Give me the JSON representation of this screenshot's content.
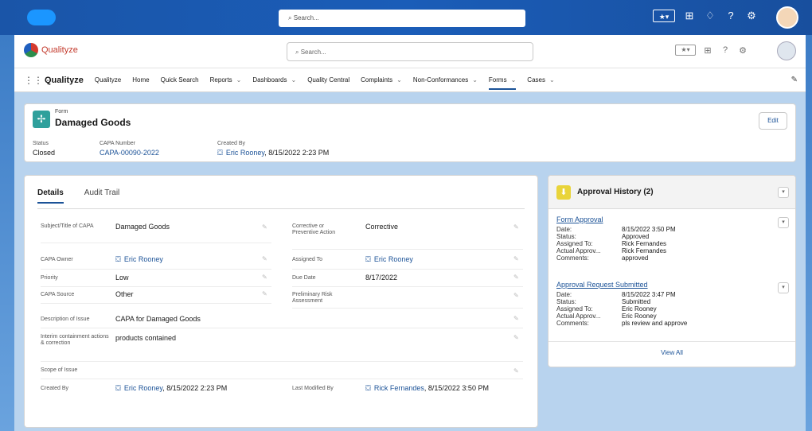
{
  "outer": {
    "search_placeholder": "Search...",
    "icons": [
      "favorites-icon",
      "add-icon",
      "bell-icon",
      "help-icon",
      "gear-icon"
    ]
  },
  "app": {
    "brand_name": "Qualityze",
    "search_placeholder": "Search...",
    "nav": {
      "app_name": "Qualityze",
      "items": [
        {
          "label": "Qualityze",
          "chevron": false
        },
        {
          "label": "Home",
          "chevron": false
        },
        {
          "label": "Quick Search",
          "chevron": false
        },
        {
          "label": "Reports",
          "chevron": true
        },
        {
          "label": "Dashboards",
          "chevron": true
        },
        {
          "label": "Quality Central",
          "chevron": false
        },
        {
          "label": "Complaints",
          "chevron": true
        },
        {
          "label": "Non-Conformances",
          "chevron": true
        },
        {
          "label": "Forms",
          "chevron": true,
          "active": true
        },
        {
          "label": "Cases",
          "chevron": true
        }
      ]
    }
  },
  "record": {
    "object_label": "Form",
    "title": "Damaged Goods",
    "edit_label": "Edit",
    "highlights": {
      "status_label": "Status",
      "status_value": "Closed",
      "capa_label": "CAPA Number",
      "capa_value": "CAPA-00090-2022",
      "created_label": "Created By",
      "created_user": "Eric Rooney",
      "created_date": ", 8/15/2022 2:23 PM"
    }
  },
  "details": {
    "tab_details": "Details",
    "tab_audit": "Audit Trail",
    "subject_label": "Subject/Title of CAPA",
    "subject_value": "Damaged Goods",
    "corrective_label": "Corrective or Preventive Action",
    "corrective_value": "Corrective",
    "owner_label": "CAPA Owner",
    "owner_value": "Eric Rooney",
    "assigned_label": "Assigned To",
    "assigned_value": "Eric Rooney",
    "priority_label": "Priority",
    "priority_value": "Low",
    "due_label": "Due Date",
    "due_value": "8/17/2022",
    "source_label": "CAPA Source",
    "source_value": "Other",
    "risk_label": "Preliminary Risk Assessment",
    "description_label": "Description of Issue",
    "description_value": "CAPA for Damaged Goods",
    "interim_label": "Interim containment actions & correction",
    "interim_value": "products contained",
    "scope_label": "Scope of Issue",
    "createdby_label": "Created By",
    "createdby_user": "Eric Rooney",
    "createdby_date": ", 8/15/2022 2:23 PM",
    "modified_label": "Last Modified By",
    "modified_user": "Rick Fernandes",
    "modified_date": ", 8/15/2022 3:50 PM"
  },
  "approval": {
    "title": "Approval History (2)",
    "view_all": "View All",
    "items": [
      {
        "title": "Form Approval",
        "date_k": "Date:",
        "date_v": "8/15/2022 3:50 PM",
        "status_k": "Status:",
        "status_v": "Approved",
        "assigned_k": "Assigned To:",
        "assigned_v": "Rick Fernandes",
        "actual_k": "Actual Approv...",
        "actual_v": "Rick Fernandes",
        "comments_k": "Comments:",
        "comments_v": "approved"
      },
      {
        "title": "Approval Request Submitted",
        "date_k": "Date:",
        "date_v": "8/15/2022 3:47 PM",
        "status_k": "Status:",
        "status_v": "Submitted",
        "assigned_k": "Assigned To:",
        "assigned_v": "Eric Rooney",
        "actual_k": "Actual Approv...",
        "actual_v": "Eric Rooney",
        "comments_k": "Comments:",
        "comments_v": "pls review and approve"
      }
    ]
  },
  "colors": {
    "accent": "#1b5297",
    "form_icon": "#2fa09c",
    "approval_icon": "#e9d43a",
    "brand_red": "#c33a2c"
  }
}
